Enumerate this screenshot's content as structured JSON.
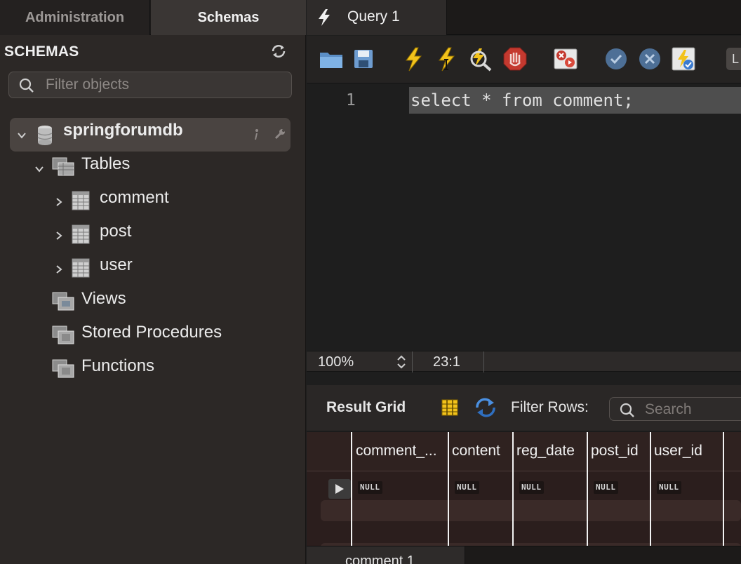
{
  "sidebar": {
    "tabs": [
      {
        "label": "Administration",
        "active": false
      },
      {
        "label": "Schemas",
        "active": true
      }
    ],
    "section_title": "SCHEMAS",
    "filter": {
      "placeholder": "Filter objects",
      "value": ""
    },
    "tree": {
      "database": {
        "name": "springforumdb",
        "expanded": true
      },
      "tables_group": {
        "label": "Tables",
        "expanded": true
      },
      "tables": [
        {
          "label": "comment"
        },
        {
          "label": "post"
        },
        {
          "label": "user"
        }
      ],
      "views_group": {
        "label": "Views"
      },
      "procedures_group": {
        "label": "Stored Procedures"
      },
      "functions_group": {
        "label": "Functions"
      }
    }
  },
  "editor_tab": {
    "label": "Query 1"
  },
  "toolbar": {
    "icons": [
      "open-file-icon",
      "save-icon",
      "execute-icon",
      "execute-current-icon",
      "explain-icon",
      "stop-icon",
      "toggle-error-icon",
      "commit-icon",
      "rollback-icon",
      "autocommit-icon"
    ],
    "limit_label": "L"
  },
  "editor": {
    "line_number": "1",
    "code": "select * from comment;"
  },
  "status": {
    "zoom": "100%",
    "cursor": "23:1"
  },
  "results": {
    "title": "Result Grid",
    "filter_label": "Filter Rows:",
    "search_placeholder": "Search",
    "columns": [
      "comment_...",
      "content",
      "reg_date",
      "post_id",
      "user_id"
    ],
    "rows": [
      [
        "NULL",
        "NULL",
        "NULL",
        "NULL",
        "NULL"
      ]
    ]
  },
  "bottom_tab": {
    "label": "comment 1"
  },
  "colors": {
    "accent_bolt": "#f2c21b",
    "stop_red": "#c4392f",
    "commit_blue": "#6b8fc2"
  }
}
